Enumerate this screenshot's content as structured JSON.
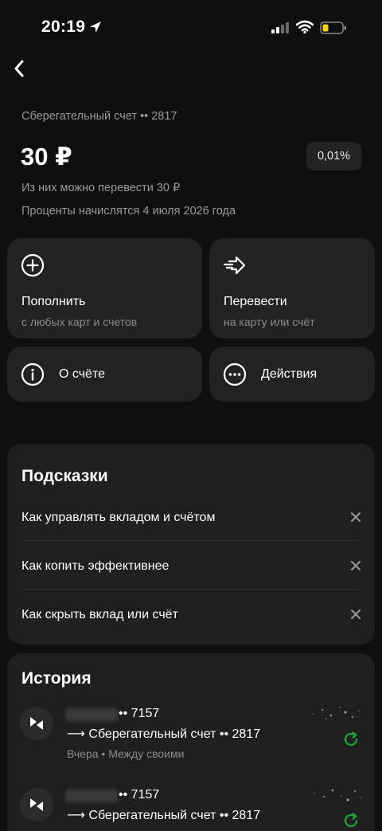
{
  "status_bar": {
    "time": "20:19",
    "icons": [
      "location-arrow-icon",
      "signal-icon",
      "wifi-icon",
      "battery-icon"
    ]
  },
  "header": {
    "back_icon": "chevron-left-icon"
  },
  "account": {
    "name": "Сберегательный счет •• 2817",
    "balance": "30 ₽",
    "rate": "0,01%",
    "transfer_available": "Из них можно перевести 30 ₽",
    "interest_date": "Проценты начислятся 4 июля 2026 года"
  },
  "actions": {
    "top_up": {
      "title": "Пополнить",
      "subtitle": "с любых карт и счетов",
      "icon": "plus-circle-icon"
    },
    "transfer": {
      "title": "Перевести",
      "subtitle": "на карту или счёт",
      "icon": "arrow-right-icon"
    },
    "about": {
      "title": "О счёте",
      "icon": "info-circle-icon"
    },
    "more": {
      "title": "Действия",
      "icon": "more-dots-icon"
    }
  },
  "hints": {
    "title": "Подсказки",
    "items": [
      {
        "label": "Как управлять вкладом и счётом"
      },
      {
        "label": "Как копить эффективнее"
      },
      {
        "label": "Как скрыть вклад или счёт"
      }
    ]
  },
  "history": {
    "title": "История",
    "items": [
      {
        "source_suffix": "•• 7157",
        "destination": "⟶ Сберегательный счет •• 2817",
        "meta": "Вчера • Между своими"
      },
      {
        "source_suffix": "•• 7157",
        "destination": "⟶ Сберегательный счет •• 2817",
        "meta": ""
      }
    ]
  },
  "colors": {
    "background": "#0f0f0f",
    "card": "#222222",
    "secondary_text": "#9a9a9a",
    "success_green": "#21a038"
  }
}
